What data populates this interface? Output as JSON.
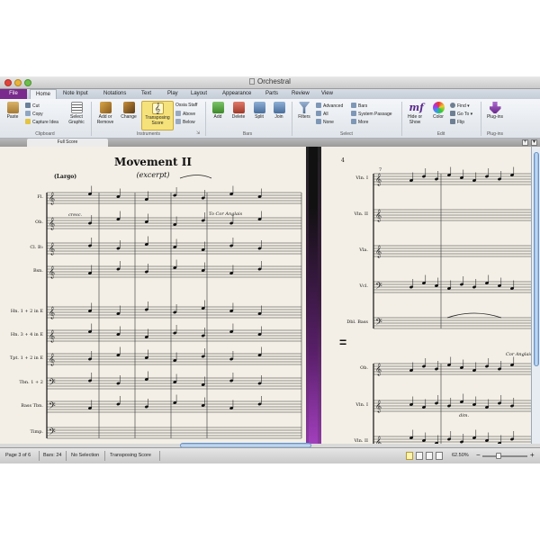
{
  "window": {
    "title": "Orchestral"
  },
  "tabs": [
    "File",
    "Home",
    "Note Input",
    "Notations",
    "Text",
    "Play",
    "Layout",
    "Appearance",
    "Parts",
    "Review",
    "View"
  ],
  "ribbon": {
    "clipboard": {
      "paste": "Paste",
      "cut": "Cut",
      "copy": "Copy",
      "capture_idea": "Capture Idea",
      "select_graphic_1": "Select",
      "select_graphic_2": "Graphic",
      "label": "Clipboard"
    },
    "instruments": {
      "add_remove_1": "Add or",
      "add_remove_2": "Remove",
      "change": "Change",
      "transposing_1": "Transposing",
      "transposing_2": "Score",
      "ossia_staff": "Ossia Staff",
      "above": "Above",
      "below": "Below",
      "label": "Instruments"
    },
    "bars": {
      "add": "Add",
      "delete": "Delete",
      "split": "Split",
      "join": "Join",
      "label": "Bars"
    },
    "select": {
      "filters": "Filters",
      "advanced": "Advanced",
      "all": "All",
      "none": "None",
      "bars": "Bars",
      "system_passage": "System Passage",
      "more": "More",
      "label": "Select"
    },
    "edit": {
      "hide_show_1": "Hide or",
      "hide_show_2": "Show",
      "color": "Color",
      "find": "Find",
      "go_to": "Go To",
      "flip": "Flip",
      "label": "Edit"
    },
    "plugins": {
      "plugins": "Plug-ins",
      "label": "Plug-ins"
    }
  },
  "doc_tab": "Full Score",
  "score": {
    "title": "Movement II",
    "subtitle": "(excerpt)",
    "tempo": "(Largo)",
    "right_page_number": "4",
    "left_instruments": [
      "Fl.",
      "Ob.",
      "Cl. B♭",
      "Bsn.",
      "Hn. 1 + 2 in E",
      "Hn. 3 + 4 in E",
      "Tpt. 1 + 2 in E",
      "Tbn. 1 + 2",
      "Bass Tbn.",
      "Timp."
    ],
    "right_instruments": [
      "Vln. I",
      "Vln. II",
      "Vla.",
      "Vcl.",
      "Dbl. Bass",
      "Ob.",
      "Vln. I",
      "Vln. II"
    ],
    "annotations": {
      "to_cor_anglais": "To Cor Anglais",
      "cor_anglais": "Cor Anglais",
      "dim": "dim.",
      "cresc": "cresc."
    },
    "bar_number": "7"
  },
  "status": {
    "page": "Page 3 of 6",
    "bars": "Bars: 24",
    "selection": "No Selection",
    "mode": "Transposing Score",
    "zoom": "62.50%"
  },
  "colors": {
    "file_tab": "#7a2a8c",
    "transposing_highlight": "#f6e27a",
    "paper": "#f3efe6",
    "scroll_thumb": "#8fb5e0"
  }
}
